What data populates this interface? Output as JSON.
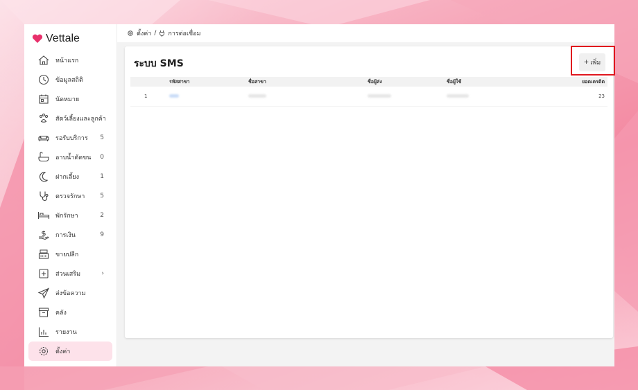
{
  "brand": {
    "name": "Vettale",
    "accent": "#e8306b"
  },
  "breadcrumb": {
    "settings": "ตั้งค่า",
    "separator": "/",
    "current": "การต่อเชื่อม"
  },
  "sidebar": {
    "items": [
      {
        "label": "หน้าแรก",
        "count": "",
        "icon": "home-icon"
      },
      {
        "label": "ข้อมูลสถิติ",
        "count": "",
        "icon": "stats-icon"
      },
      {
        "label": "นัดหมาย",
        "count": "",
        "icon": "calendar-icon"
      },
      {
        "label": "สัตว์เลี้ยงและลูกค้า",
        "count": "",
        "icon": "paw-icon"
      },
      {
        "label": "รอรับบริการ",
        "count": "5",
        "icon": "sofa-icon"
      },
      {
        "label": "อาบน้ำตัดขน",
        "count": "0",
        "icon": "bath-icon"
      },
      {
        "label": "ฝากเลี้ยง",
        "count": "1",
        "icon": "moon-icon"
      },
      {
        "label": "ตรวจรักษา",
        "count": "5",
        "icon": "stethoscope-icon"
      },
      {
        "label": "พักรักษา",
        "count": "2",
        "icon": "bed-icon"
      },
      {
        "label": "การเงิน",
        "count": "9",
        "icon": "money-icon"
      },
      {
        "label": "ขายปลีก",
        "count": "",
        "icon": "cash-register-icon"
      },
      {
        "label": "ส่วนเสริม",
        "count": "›",
        "icon": "plus-box-icon"
      },
      {
        "label": "ส่งข้อความ",
        "count": "",
        "icon": "send-icon"
      },
      {
        "label": "คลัง",
        "count": "",
        "icon": "archive-icon"
      },
      {
        "label": "รายงาน",
        "count": "",
        "icon": "chart-icon"
      },
      {
        "label": "ตั้งค่า",
        "count": "",
        "icon": "gear-icon",
        "active": true
      }
    ]
  },
  "page": {
    "title": "ระบบ SMS",
    "add_button": {
      "icon": "+",
      "label": "เพิ่ม"
    }
  },
  "table": {
    "headers": [
      "",
      "รหัสสาขา",
      "ชื่อสาขา",
      "ชื่อผู้ส่ง",
      "ชื่อผู้ใช้",
      "ยอดเครดิต"
    ],
    "rows": [
      {
        "index": "1",
        "credit": "23"
      }
    ]
  }
}
